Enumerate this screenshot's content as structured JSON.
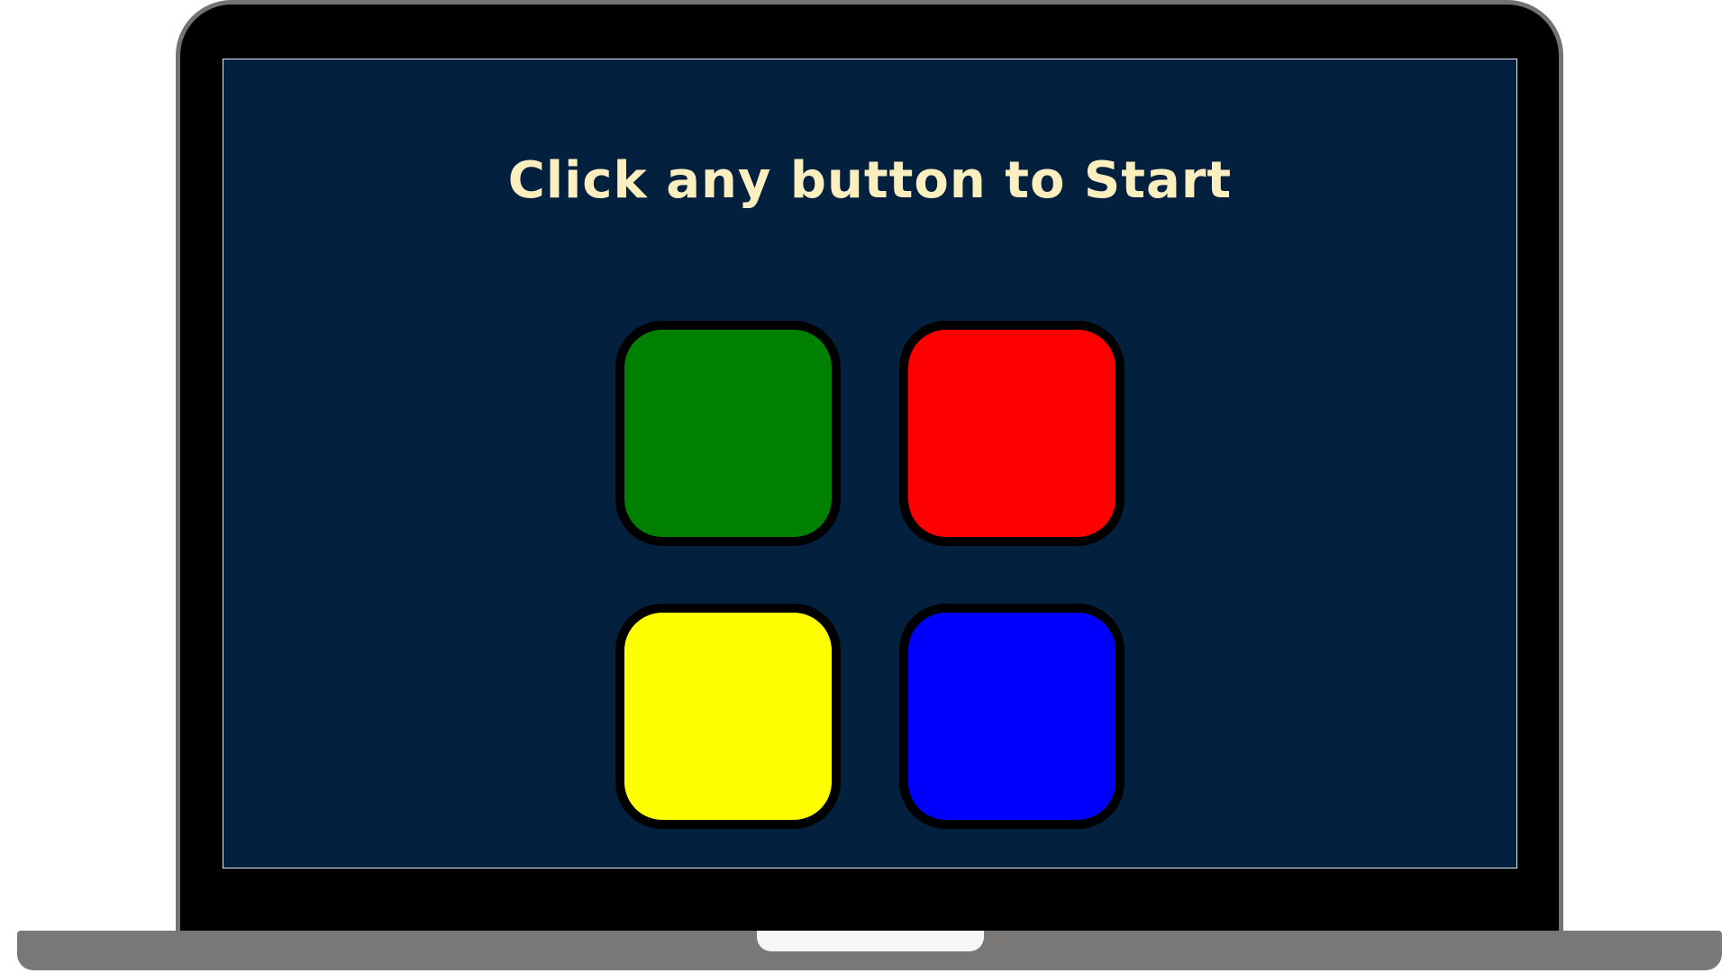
{
  "game": {
    "message": "Click any button to Start"
  },
  "pads": [
    {
      "name": "green",
      "color": "#008000"
    },
    {
      "name": "red",
      "color": "#ff0000"
    },
    {
      "name": "yellow",
      "color": "#ffff00"
    },
    {
      "name": "blue",
      "color": "#0000ff"
    }
  ],
  "colors": {
    "screen_background": "#03203f",
    "message_text": "#fcefbf",
    "bezel": "#000000",
    "laptop_body": "#7a7877"
  }
}
